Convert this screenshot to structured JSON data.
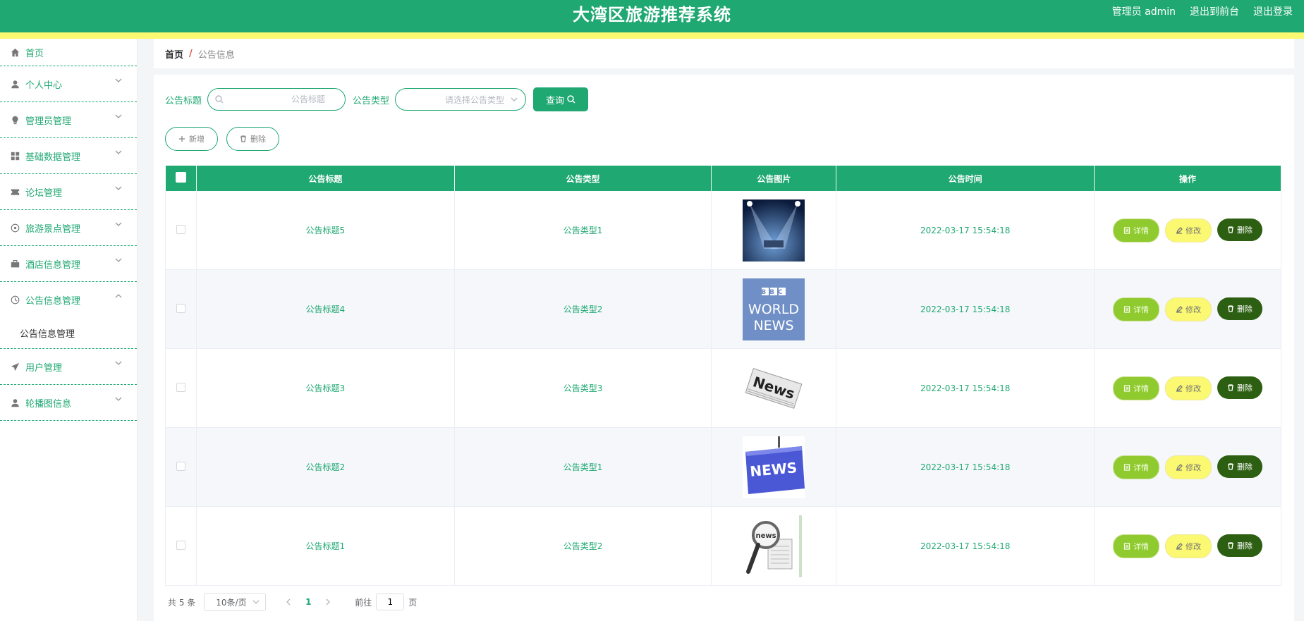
{
  "header": {
    "title": "大湾区旅游推荐系统",
    "user": "管理员 admin",
    "to_front": "退出到前台",
    "logout": "退出登录",
    "colors": {
      "primary": "#1fa872",
      "accent": "#fbf871"
    }
  },
  "sidebar": {
    "items": [
      {
        "label": "首页",
        "icon": "home-icon"
      },
      {
        "label": "个人中心",
        "icon": "user-icon"
      },
      {
        "label": "管理员管理",
        "icon": "bulb-icon"
      },
      {
        "label": "基础数据管理",
        "icon": "grid-icon"
      },
      {
        "label": "论坛管理",
        "icon": "ticket-icon"
      },
      {
        "label": "旅游景点管理",
        "icon": "compass-icon"
      },
      {
        "label": "酒店信息管理",
        "icon": "briefcase-icon"
      },
      {
        "label": "公告信息管理",
        "icon": "clock-icon",
        "expanded": true
      },
      {
        "label": "用户管理",
        "icon": "send-icon"
      },
      {
        "label": "轮播图信息",
        "icon": "user-icon"
      }
    ],
    "submenu_label": "公告信息管理"
  },
  "breadcrumb": {
    "home": "首页",
    "separator": "/",
    "current": "公告信息"
  },
  "search": {
    "title_label": "公告标题",
    "title_placeholder": "公告标题",
    "type_label": "公告类型",
    "type_placeholder": "请选择公告类型",
    "query_button": "查询"
  },
  "actions": {
    "add": "新增",
    "delete": "删除"
  },
  "table": {
    "columns": [
      "公告标题",
      "公告类型",
      "公告图片",
      "公告时间",
      "操作"
    ],
    "rows": [
      {
        "title": "公告标题5",
        "type": "公告类型1",
        "image": "stage-spotlight",
        "time": "2022-03-17 15:54:18"
      },
      {
        "title": "公告标题4",
        "type": "公告类型2",
        "image": "bbc-world-news",
        "time": "2022-03-17 15:54:18"
      },
      {
        "title": "公告标题3",
        "type": "公告类型3",
        "image": "news-paper",
        "time": "2022-03-17 15:54:18"
      },
      {
        "title": "公告标题2",
        "type": "公告类型1",
        "image": "news-key",
        "time": "2022-03-17 15:54:18"
      },
      {
        "title": "公告标题1",
        "type": "公告类型2",
        "image": "magnifier-news",
        "time": "2022-03-17 15:54:18"
      }
    ],
    "row_actions": {
      "detail": "详情",
      "edit": "修改",
      "delete": "删除"
    },
    "image_text": {
      "bbc": "BBC",
      "world": "WORLD",
      "news_upper": "NEWS",
      "news_title": "News",
      "news_lower": "news"
    }
  },
  "pagination": {
    "total": "共 5 条",
    "page_size": "10条/页",
    "current_page": "1",
    "goto_label": "前往",
    "goto_value": "1",
    "page_suffix": "页"
  }
}
